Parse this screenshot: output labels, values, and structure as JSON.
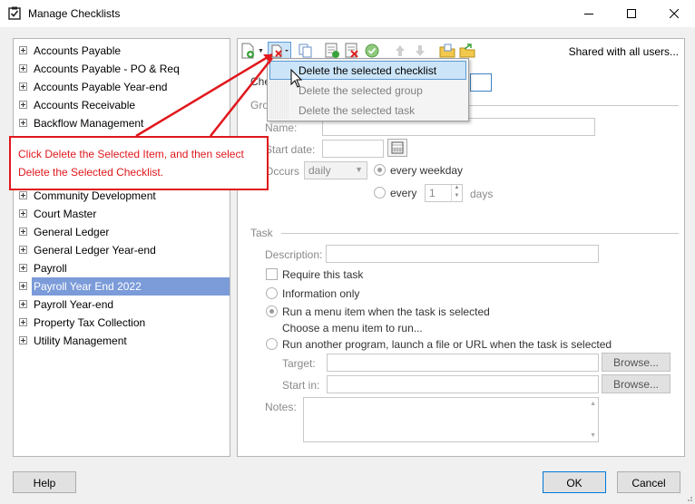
{
  "window": {
    "title": "Manage Checklists",
    "minimize_icon": "minimize-icon",
    "maximize_icon": "maximize-icon",
    "close_icon": "close-icon"
  },
  "tree": {
    "items": [
      {
        "label": "Accounts Payable"
      },
      {
        "label": "Accounts Payable - PO & Req"
      },
      {
        "label": "Accounts Payable Year-end"
      },
      {
        "label": "Accounts Receivable"
      },
      {
        "label": "Backflow Management"
      },
      {
        "label": "Community Development"
      },
      {
        "label": "Court Master"
      },
      {
        "label": "General Ledger"
      },
      {
        "label": "General Ledger Year-end"
      },
      {
        "label": "Payroll"
      },
      {
        "label": "Payroll Year End 2022",
        "selected": true
      },
      {
        "label": "Payroll Year-end"
      },
      {
        "label": "Property Tax Collection"
      },
      {
        "label": "Utility Management"
      }
    ]
  },
  "toolbar": {
    "shared_label": "Shared with all users..."
  },
  "menu": {
    "items": [
      {
        "label": "Delete the selected checklist",
        "active": true
      },
      {
        "label": "Delete the selected group"
      },
      {
        "label": "Delete the selected task"
      }
    ]
  },
  "callout": {
    "text": "Click Delete the Selected Item, and then select Delete the Selected Checklist."
  },
  "checklist": {
    "label_fragment": "Che"
  },
  "group": {
    "legend_fragment": "Gro",
    "name_label": "Name:",
    "start_date_label": "Start date:",
    "occurs_label": "Occurs",
    "occurs_value": "daily",
    "every_weekday_label": "every weekday",
    "every_label": "every",
    "every_value": "1",
    "days_label": "days"
  },
  "task": {
    "legend": "Task",
    "description_label": "Description:",
    "require_label": "Require this task",
    "info_only_label": "Information only",
    "run_menu_label": "Run a menu item when the task is selected",
    "choose_menu_label": "Choose a menu item to run...",
    "run_program_label": "Run another program, launch a file or URL when the task is selected",
    "target_label": "Target:",
    "start_in_label": "Start in:",
    "browse_label": "Browse...",
    "notes_label": "Notes:"
  },
  "footer": {
    "help_label": "Help",
    "ok_label": "OK",
    "cancel_label": "Cancel"
  },
  "colors": {
    "callout_red": "#e0181d",
    "selection_blue": "#7b9bd9",
    "menu_highlight": "#cce4f7"
  }
}
